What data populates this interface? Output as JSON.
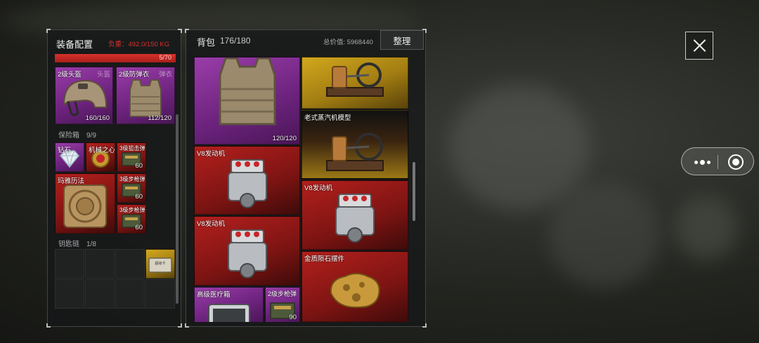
{
  "equipment": {
    "title": "装备配置",
    "load": "负重：492.0/150 KG",
    "load_bar_text": "5/70",
    "slots": [
      {
        "name": "2级头盔",
        "type": "头盔",
        "durability": "160/160"
      },
      {
        "name": "2级防弹衣",
        "type": "弹衣",
        "durability": "112/120"
      }
    ],
    "safebox": {
      "label": "保险箱",
      "count": "9/9",
      "items": [
        {
          "name": "钻石",
          "qty": ""
        },
        {
          "name": "机械之心",
          "qty": ""
        },
        {
          "name": "3级狙击弹",
          "qty": "60"
        },
        {
          "name": "玛雅历法",
          "qty": ""
        },
        {
          "name": "3级步枪弹",
          "qty": "60"
        },
        {
          "name": "3级步枪弹",
          "qty": "60"
        }
      ]
    },
    "keychain": {
      "label": "钥匙链",
      "count": "1/8",
      "item_text": "超级卡"
    }
  },
  "bag": {
    "title": "背包",
    "count": "176/180",
    "total_value": "总价值: 5968440",
    "sort_label": "整理",
    "items": [
      {
        "name": "",
        "durability": "120/120"
      },
      {
        "name": ""
      },
      {
        "name": "老式蒸汽机模型"
      },
      {
        "name": "V8发动机"
      },
      {
        "name": "V8发动机"
      },
      {
        "name": "V8发动机"
      },
      {
        "name": "金质陨石摆件"
      },
      {
        "name": "高级医疗箱"
      },
      {
        "name": "2级步枪弹",
        "qty": "90"
      }
    ]
  },
  "colors": {
    "rarity_purple": "#8a34a0",
    "rarity_red": "#a51c1a",
    "rarity_gold": "#c99f1a",
    "load_red": "#d9302c"
  }
}
